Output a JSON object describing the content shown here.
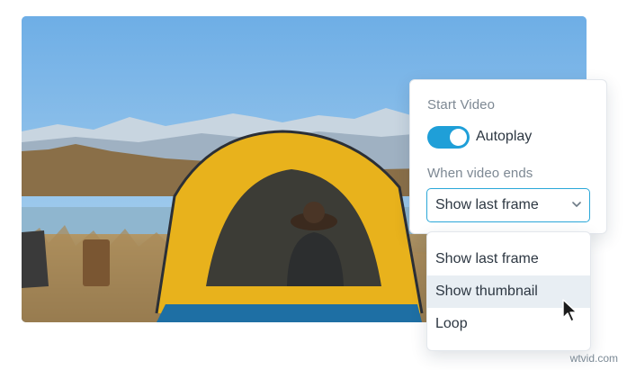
{
  "video": {
    "description_icon": "video-preview"
  },
  "settings": {
    "start_video_label": "Start Video",
    "autoplay": {
      "label": "Autoplay",
      "enabled": true,
      "color": "#1f9fd8"
    },
    "when_ends_label": "When video ends",
    "select": {
      "value": "Show last frame",
      "icon": "chevron-down-icon"
    }
  },
  "dropdown": {
    "options": [
      {
        "label": "Show last frame",
        "highlighted": false
      },
      {
        "label": "Show thumbnail",
        "highlighted": true
      },
      {
        "label": "Loop",
        "highlighted": false
      }
    ]
  },
  "watermark": "wtvid.com",
  "colors": {
    "accent": "#1f9fd8",
    "select_border": "#2aa7d8",
    "hover_row": "#e8eef3"
  }
}
